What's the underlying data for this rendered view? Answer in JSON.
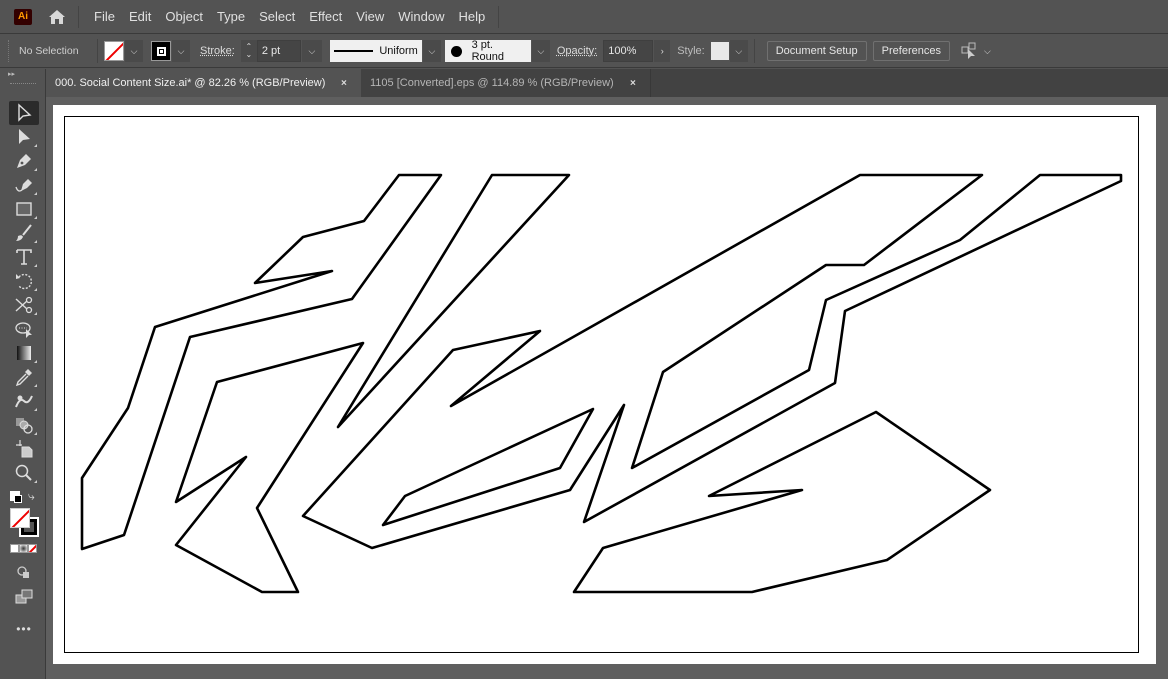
{
  "app": {
    "logo": "Ai",
    "home_icon": "home-icon"
  },
  "menu": [
    "File",
    "Edit",
    "Object",
    "Type",
    "Select",
    "Effect",
    "View",
    "Window",
    "Help"
  ],
  "control_bar": {
    "selection_status": "No Selection",
    "fill": "none",
    "stroke_label": "Stroke:",
    "stroke_weight": "2 pt",
    "variable_width_profile": "Uniform",
    "brush": "3 pt. Round",
    "opacity_label": "Opacity:",
    "opacity": "100%",
    "style_label": "Style:",
    "document_setup": "Document Setup",
    "preferences": "Preferences",
    "arrange_icon": "arrange-documents-icon"
  },
  "tabs": [
    {
      "title": "000. Social Content Size.ai* @ 82.26 % (RGB/Preview)",
      "active": true,
      "close": "×"
    },
    {
      "title": "1105 [Converted].eps @ 114.89 % (RGB/Preview)",
      "active": false,
      "close": "×"
    }
  ],
  "tools": [
    {
      "name": "selection-tool",
      "active": true
    },
    {
      "name": "direct-selection-tool"
    },
    {
      "name": "pen-tool"
    },
    {
      "name": "curvature-tool"
    },
    {
      "name": "rectangle-tool"
    },
    {
      "name": "paintbrush-tool"
    },
    {
      "name": "type-tool"
    },
    {
      "name": "rotate-tool"
    },
    {
      "name": "scissors-tool"
    },
    {
      "name": "puppet-warp-tool"
    },
    {
      "name": "gradient-tool"
    },
    {
      "name": "eyedropper-tool"
    },
    {
      "name": "blend-tool"
    },
    {
      "name": "shape-builder-tool"
    },
    {
      "name": "artboard-tool"
    },
    {
      "name": "zoom-tool"
    }
  ],
  "more_tools": "•••",
  "artwork": {
    "stroke_color": "#000000",
    "fill_color": "none"
  }
}
